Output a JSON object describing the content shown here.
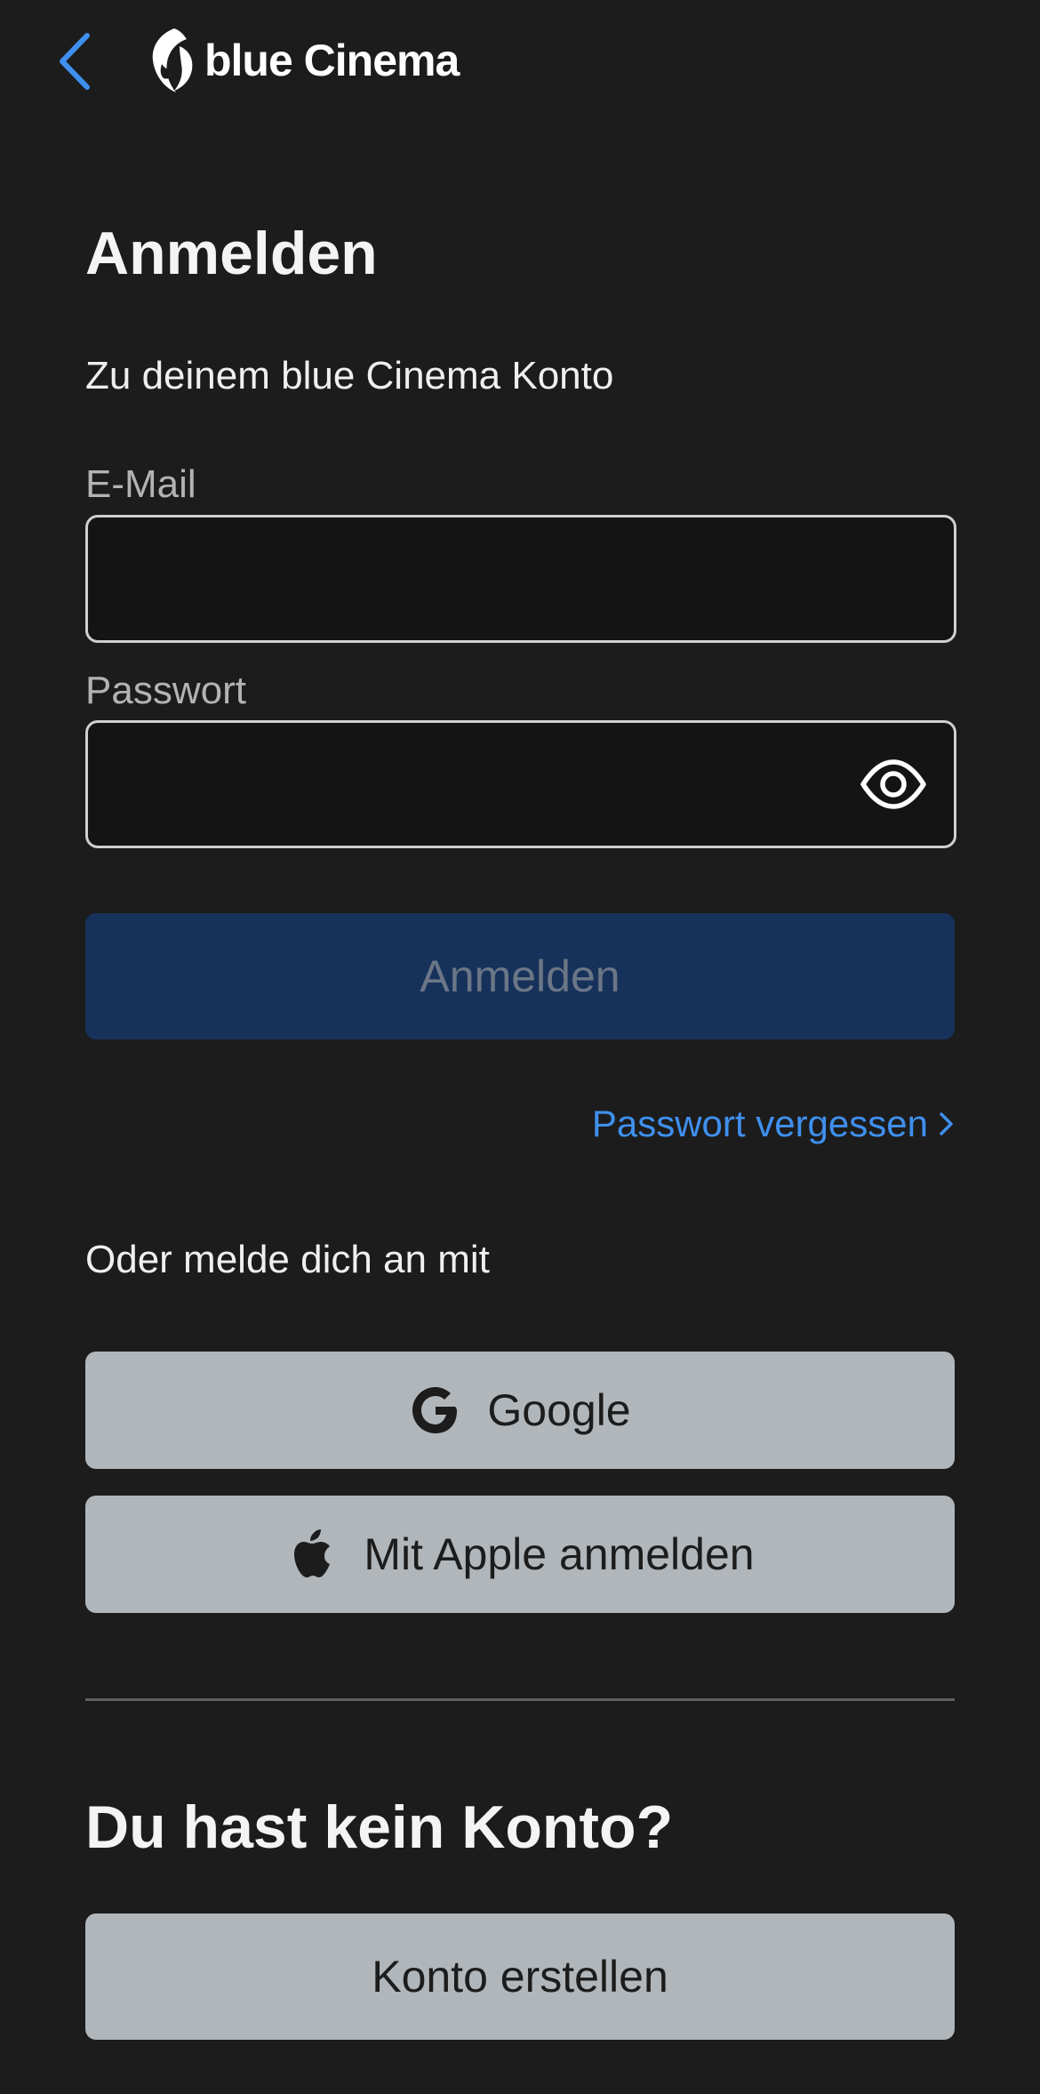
{
  "header": {
    "back_icon": "chevron-left-icon",
    "logo_text": "blue Cinema"
  },
  "login": {
    "title": "Anmelden",
    "subtitle": "Zu deinem blue Cinema Konto",
    "email_label": "E-Mail",
    "email_value": "",
    "password_label": "Passwort",
    "password_value": "",
    "password_toggle_icon": "eye-icon",
    "submit_label": "Anmelden",
    "forgot_label": "Passwort vergessen"
  },
  "social": {
    "intro": "Oder melde dich an mit",
    "google_label": "Google",
    "google_icon": "google-icon",
    "apple_label": "Mit Apple anmelden",
    "apple_icon": "apple-icon"
  },
  "register": {
    "title": "Du hast kein Konto?",
    "create_label": "Konto erstellen"
  },
  "colors": {
    "background": "#1c1c1d",
    "accent": "#3f90ee",
    "primary_button_disabled": "#17325a",
    "secondary_button": "#b1b6ba"
  }
}
